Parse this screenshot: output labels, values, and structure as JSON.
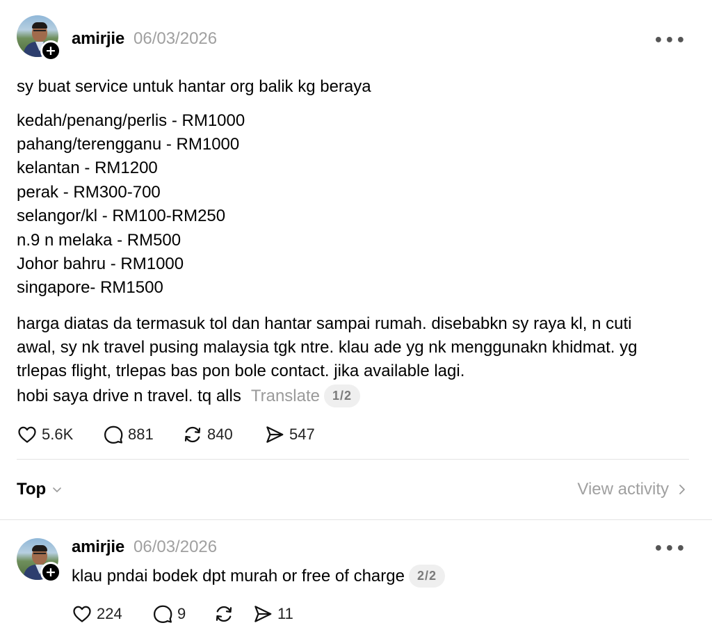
{
  "post": {
    "username": "amirjie",
    "date": "06/03/2026",
    "more_label": "•••",
    "follow_symbol": "+",
    "intro": "sy buat service untuk hantar org balik kg beraya",
    "prices": [
      "kedah/penang/perlis - RM1000",
      "pahang/terengganu - RM1000",
      "kelantan - RM1200",
      "perak - RM300-700",
      "selangor/kl - RM100-RM250",
      "n.9 n melaka - RM500",
      "Johor bahru - RM1000",
      "singapore- RM1500"
    ],
    "body_lines": [
      "harga diatas da termasuk tol dan hantar sampai rumah. disebabkn sy raya kl, n cuti",
      "awal, sy nk travel pusing malaysia tgk ntre. klau ade yg nk menggunakn khidmat. yg",
      "trlepas flight, trlepas bas pon bole contact. jika available lagi.",
      "hobi saya drive n travel. tq alls"
    ],
    "translate_label": "Translate",
    "pager": "1/2",
    "likes": "5.6K",
    "comments": "881",
    "reposts": "840",
    "shares": "547"
  },
  "sort": {
    "label": "Top"
  },
  "view_activity": {
    "label": "View activity"
  },
  "reply": {
    "username": "amirjie",
    "date": "06/03/2026",
    "more_label": "•••",
    "follow_symbol": "+",
    "text": "klau pndai bodek dpt murah or free of charge",
    "pager": "2/2",
    "likes": "224",
    "comments": "9",
    "shares": "11"
  },
  "icons": {
    "like": "heart-icon",
    "comment": "speech-bubble-icon",
    "repost": "repost-arrows-icon",
    "share": "paper-plane-icon"
  }
}
